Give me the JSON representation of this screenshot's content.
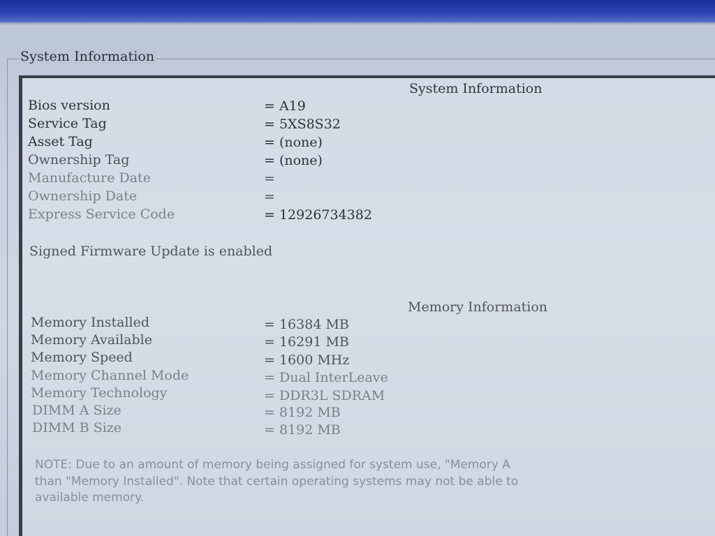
{
  "group_title": "System Information",
  "system_section": {
    "heading": "System Information",
    "rows": [
      {
        "label": "Bios version",
        "value": "= A19"
      },
      {
        "label": "Service Tag",
        "value": "= 5XS8S32"
      },
      {
        "label": "Asset Tag",
        "value": "= (none)"
      },
      {
        "label": "Ownership Tag",
        "value": "= (none)"
      },
      {
        "label": "Manufacture Date",
        "value": "="
      },
      {
        "label": "Ownership Date",
        "value": "="
      },
      {
        "label": "Express Service Code",
        "value": "= 12926734382"
      }
    ],
    "firmware_status": "Signed Firmware Update is enabled"
  },
  "memory_section": {
    "heading": "Memory Information",
    "rows": [
      {
        "label": "Memory Installed",
        "value": "= 16384 MB"
      },
      {
        "label": "Memory Available",
        "value": "= 16291 MB"
      },
      {
        "label": "Memory Speed",
        "value": "= 1600 MHz"
      },
      {
        "label": "Memory Channel Mode",
        "value": "= Dual InterLeave"
      },
      {
        "label": "Memory Technology",
        "value": "= DDR3L SDRAM"
      },
      {
        "label": "DIMM A Size",
        "value": "= 8192 MB"
      },
      {
        "label": "DIMM B Size",
        "value": "= 8192 MB"
      }
    ],
    "note_lines": [
      "NOTE: Due to an amount of memory being assigned for system use, \"Memory A",
      "than \"Memory Installed\". Note that certain operating systems may not be able to",
      "available memory."
    ]
  }
}
